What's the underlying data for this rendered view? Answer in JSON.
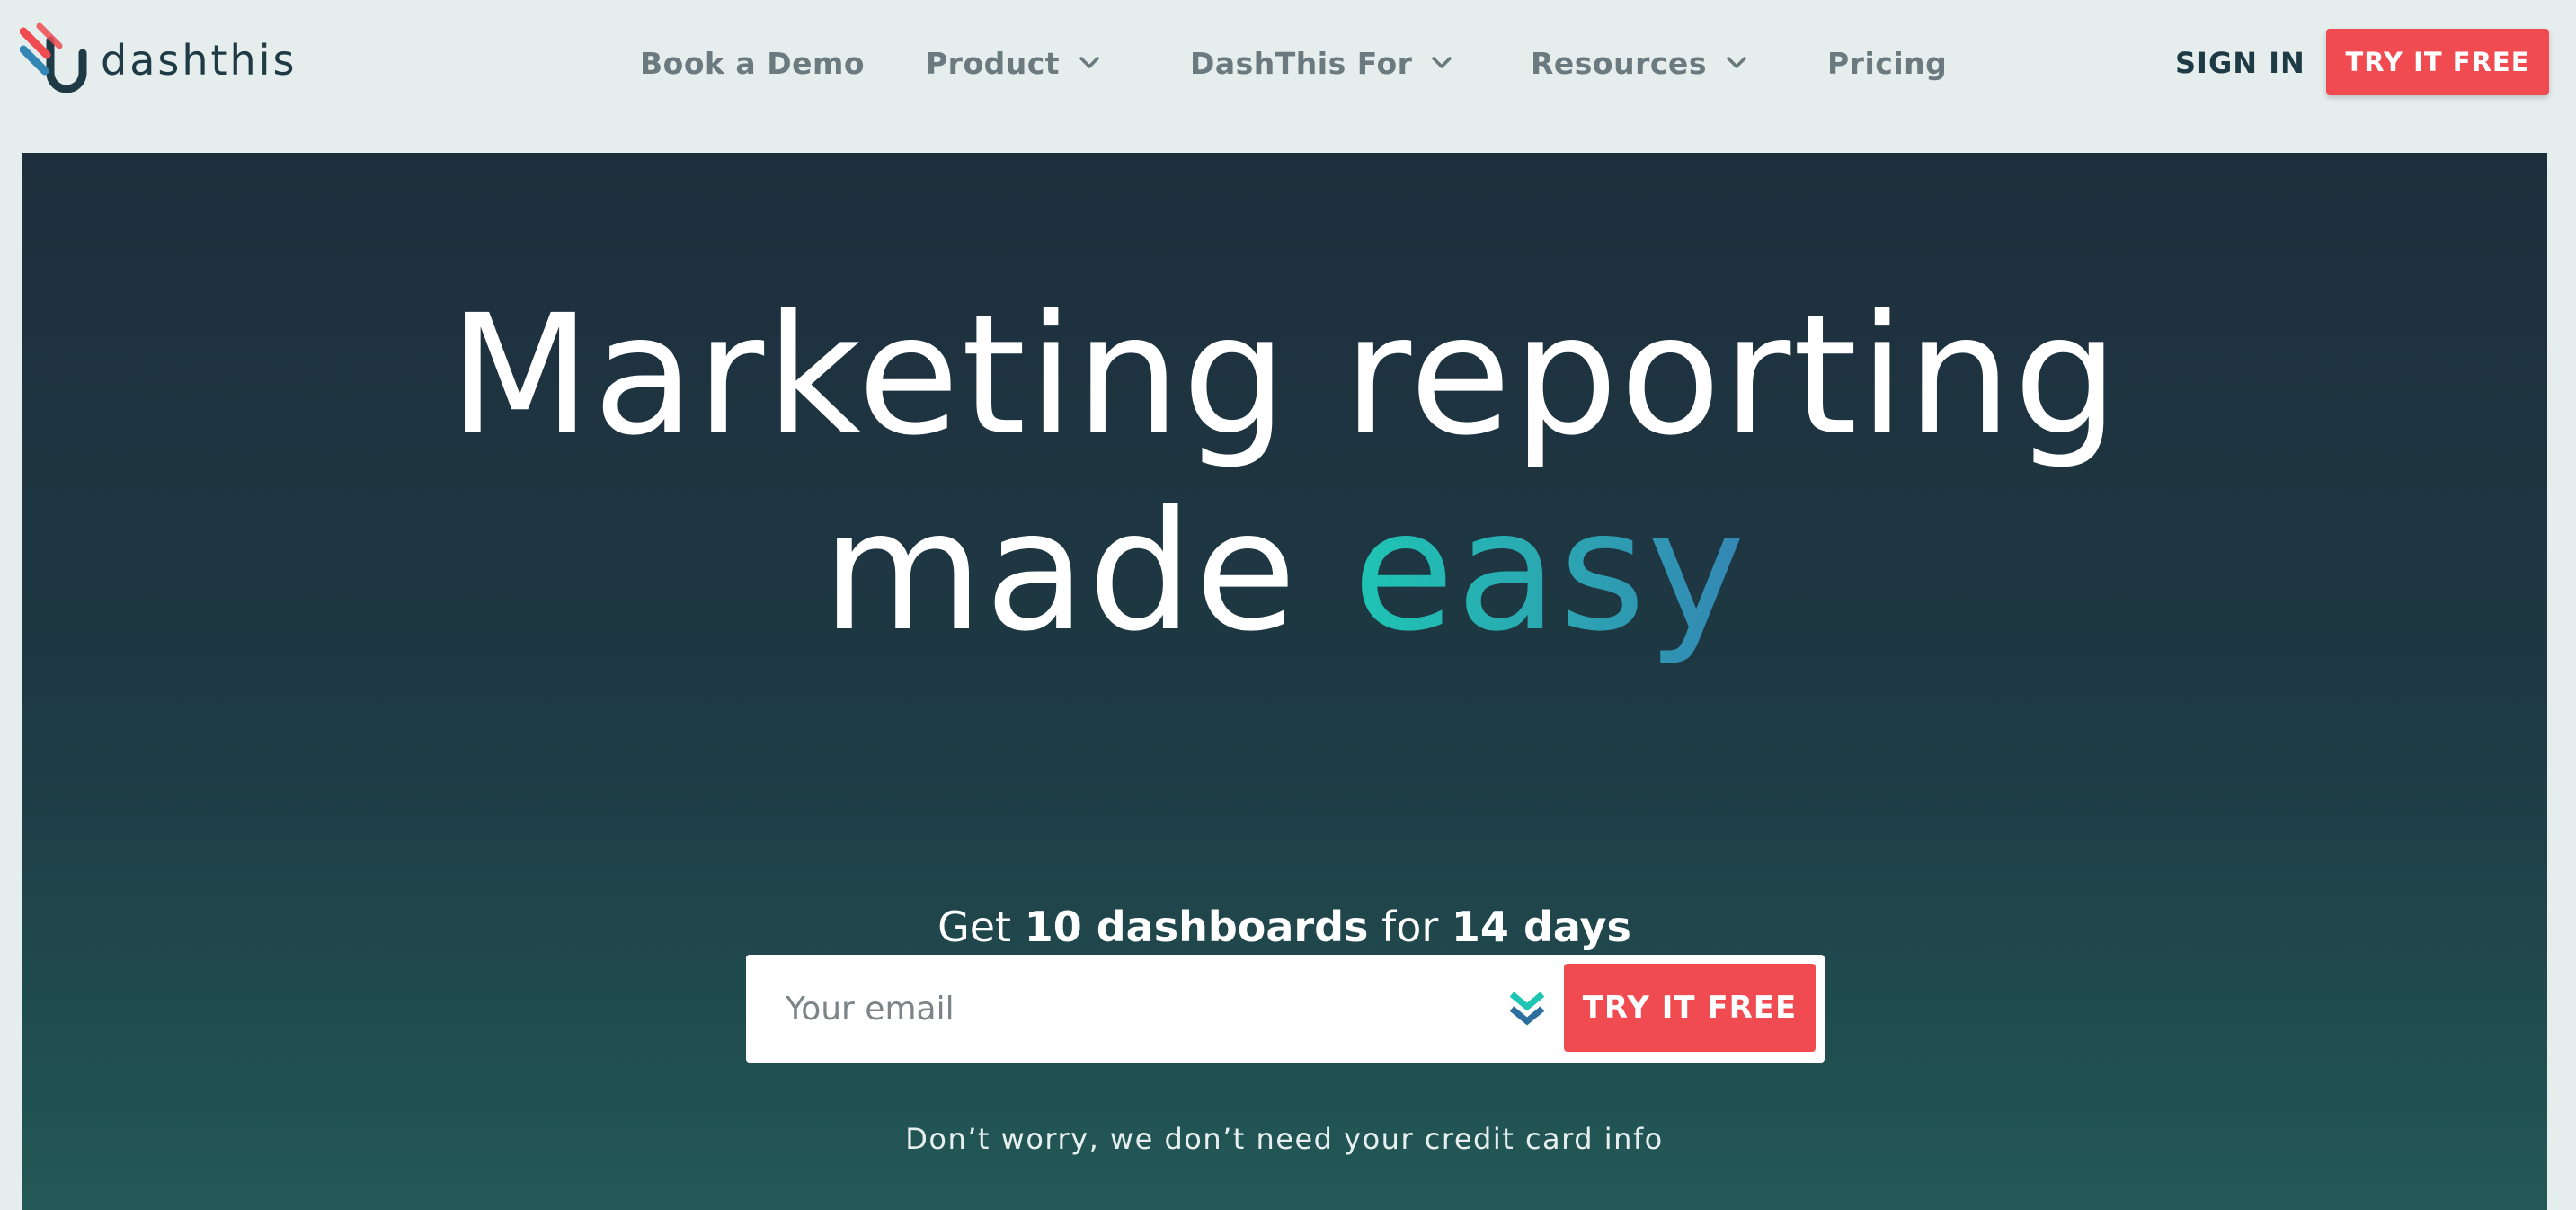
{
  "brand": {
    "name": "dashthis",
    "colors": {
      "accent_red": "#ef4b51",
      "navy": "#1d3a45",
      "teal": "#1ec5b4",
      "blue": "#3486b4",
      "nav_gray": "#6b7a7e"
    }
  },
  "nav": {
    "items": [
      {
        "label": "Book a Demo",
        "has_dropdown": false
      },
      {
        "label": "Product",
        "has_dropdown": true
      },
      {
        "label": "DashThis For",
        "has_dropdown": true
      },
      {
        "label": "Resources",
        "has_dropdown": true
      },
      {
        "label": "Pricing",
        "has_dropdown": false
      }
    ],
    "sign_in_label": "SIGN IN",
    "try_label": "TRY IT FREE"
  },
  "hero": {
    "headline_line1": "Marketing reporting",
    "headline_line2_prefix": "made",
    "headline_highlight": "easy",
    "offer": {
      "prefix": "Get",
      "count": "10 dashboards",
      "mid": "for",
      "duration": "14 days"
    },
    "email_placeholder": "Your email",
    "cta_label": "TRY IT FREE",
    "note": "Don’t worry, we don’t need your credit card info"
  },
  "icons": {
    "logo": "dashthis-logo-icon",
    "dropdown": "chevron-down-icon",
    "form_arrows": "double-chevron-down-icon"
  }
}
